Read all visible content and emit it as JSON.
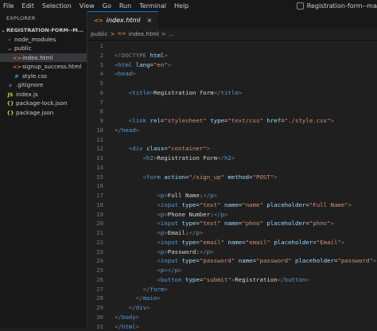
{
  "menu": [
    "File",
    "Edit",
    "Selection",
    "View",
    "Go",
    "Run",
    "Terminal",
    "Help"
  ],
  "window_title": "Registration-form--ma",
  "explorer": {
    "header": "EXPLORER",
    "root": "REGISTRATION-FORM--M...",
    "items": [
      {
        "label": "node_modules",
        "icon": "folder-collapsed",
        "indent": 1
      },
      {
        "label": "public",
        "icon": "folder-expanded",
        "indent": 1
      },
      {
        "label": "index.html",
        "icon": "html-icon",
        "indent": 2,
        "selected": true
      },
      {
        "label": "signup_success.html",
        "icon": "html-icon",
        "indent": 2
      },
      {
        "label": "style.css",
        "icon": "css-icon",
        "indent": 2
      },
      {
        "label": ".gitignore",
        "icon": "git-icon",
        "indent": 1
      },
      {
        "label": "index.js",
        "icon": "js-icon",
        "indent": 1
      },
      {
        "label": "package-lock.json",
        "icon": "json-icon",
        "indent": 1
      },
      {
        "label": "package.json",
        "icon": "json-icon",
        "indent": 1
      }
    ]
  },
  "tab": {
    "label": "index.html",
    "close": "×"
  },
  "breadcrumb": [
    "public",
    ">",
    "index.html",
    ">",
    "..."
  ],
  "code_lines": [
    [
      [
        "",
        ""
      ]
    ],
    [
      [
        "<!DOCTYPE ",
        "t"
      ],
      [
        "html",
        "a"
      ],
      [
        ">",
        "t"
      ]
    ],
    [
      [
        "<",
        "t"
      ],
      [
        "html",
        "g"
      ],
      [
        " ",
        ""
      ],
      [
        "lang",
        "a"
      ],
      [
        "=",
        "w"
      ],
      [
        "\"en\"",
        "s"
      ],
      [
        ">",
        "t"
      ]
    ],
    [
      [
        "<",
        "t"
      ],
      [
        "head",
        "g"
      ],
      [
        ">",
        "t"
      ]
    ],
    [
      [
        "",
        ""
      ]
    ],
    [
      [
        "    <",
        "t"
      ],
      [
        "title",
        "g"
      ],
      [
        ">",
        "t"
      ],
      [
        "Registration form",
        "w"
      ],
      [
        "</",
        "t"
      ],
      [
        "title",
        "g"
      ],
      [
        ">",
        "t"
      ]
    ],
    [
      [
        "",
        ""
      ]
    ],
    [
      [
        "",
        ""
      ]
    ],
    [
      [
        "    <",
        "t"
      ],
      [
        "link",
        "g"
      ],
      [
        " ",
        ""
      ],
      [
        "rel",
        "a"
      ],
      [
        "=",
        "w"
      ],
      [
        "\"stylesheet\"",
        "s"
      ],
      [
        " ",
        ""
      ],
      [
        "type",
        "a"
      ],
      [
        "=",
        "w"
      ],
      [
        "\"text/css\"",
        "s"
      ],
      [
        " ",
        ""
      ],
      [
        "href",
        "a"
      ],
      [
        "=",
        "w"
      ],
      [
        "\"./style.css\"",
        "s"
      ],
      [
        ">",
        "t"
      ]
    ],
    [
      [
        "</",
        "t"
      ],
      [
        "head",
        "g"
      ],
      [
        ">",
        "t"
      ]
    ],
    [
      [
        "",
        ""
      ]
    ],
    [
      [
        "    <",
        "t"
      ],
      [
        "div",
        "g"
      ],
      [
        " ",
        ""
      ],
      [
        "class",
        "a"
      ],
      [
        "=",
        "w"
      ],
      [
        "\"container\"",
        "s"
      ],
      [
        ">",
        "t"
      ]
    ],
    [
      [
        "        <",
        "t"
      ],
      [
        "h2",
        "g"
      ],
      [
        ">",
        "t"
      ],
      [
        "Registration Form",
        "w"
      ],
      [
        "</",
        "t"
      ],
      [
        "h2",
        "g"
      ],
      [
        ">",
        "t"
      ]
    ],
    [
      [
        "",
        ""
      ]
    ],
    [
      [
        "        <",
        "t"
      ],
      [
        "form",
        "g"
      ],
      [
        " ",
        ""
      ],
      [
        "action",
        "a"
      ],
      [
        "=",
        "w"
      ],
      [
        "\"/sign_up\"",
        "s"
      ],
      [
        " ",
        ""
      ],
      [
        "method",
        "a"
      ],
      [
        "=",
        "w"
      ],
      [
        "\"POST\"",
        "s"
      ],
      [
        ">",
        "t"
      ]
    ],
    [
      [
        "",
        ""
      ]
    ],
    [
      [
        "            <",
        "t"
      ],
      [
        "p",
        "g"
      ],
      [
        ">",
        "t"
      ],
      [
        "Full Name:",
        "w"
      ],
      [
        "</",
        "t"
      ],
      [
        "p",
        "g"
      ],
      [
        ">",
        "t"
      ]
    ],
    [
      [
        "            <",
        "t"
      ],
      [
        "input",
        "g"
      ],
      [
        " ",
        ""
      ],
      [
        "type",
        "a"
      ],
      [
        "=",
        "w"
      ],
      [
        "\"text\"",
        "s"
      ],
      [
        " ",
        ""
      ],
      [
        "name",
        "a"
      ],
      [
        "=",
        "w"
      ],
      [
        "\"name\"",
        "s"
      ],
      [
        " ",
        ""
      ],
      [
        "placeholder",
        "a"
      ],
      [
        "=",
        "w"
      ],
      [
        "\"Full Name\"",
        "s"
      ],
      [
        ">",
        "t"
      ]
    ],
    [
      [
        "            <",
        "t"
      ],
      [
        "p",
        "g"
      ],
      [
        ">",
        "t"
      ],
      [
        "Phone Number:",
        "w"
      ],
      [
        "</",
        "t"
      ],
      [
        "p",
        "g"
      ],
      [
        ">",
        "t"
      ]
    ],
    [
      [
        "            <",
        "t"
      ],
      [
        "input",
        "g"
      ],
      [
        " ",
        ""
      ],
      [
        "type",
        "a"
      ],
      [
        "=",
        "w"
      ],
      [
        "\"text\"",
        "s"
      ],
      [
        " ",
        ""
      ],
      [
        "name",
        "a"
      ],
      [
        "=",
        "w"
      ],
      [
        "\"phno\"",
        "s"
      ],
      [
        " ",
        ""
      ],
      [
        "placeholder",
        "a"
      ],
      [
        "=",
        "w"
      ],
      [
        "\"phno\"",
        "s"
      ],
      [
        ">",
        "t"
      ]
    ],
    [
      [
        "            <",
        "t"
      ],
      [
        "p",
        "g"
      ],
      [
        ">",
        "t"
      ],
      [
        "Email:",
        "w"
      ],
      [
        "</",
        "t"
      ],
      [
        "p",
        "g"
      ],
      [
        ">",
        "t"
      ]
    ],
    [
      [
        "            <",
        "t"
      ],
      [
        "input",
        "g"
      ],
      [
        " ",
        ""
      ],
      [
        "type",
        "a"
      ],
      [
        "=",
        "w"
      ],
      [
        "\"email\"",
        "s"
      ],
      [
        " ",
        ""
      ],
      [
        "name",
        "a"
      ],
      [
        "=",
        "w"
      ],
      [
        "\"email\"",
        "s"
      ],
      [
        " ",
        ""
      ],
      [
        "placeholder",
        "a"
      ],
      [
        "=",
        "w"
      ],
      [
        "\"Email\"",
        "s"
      ],
      [
        ">",
        "t"
      ]
    ],
    [
      [
        "            <",
        "t"
      ],
      [
        "p",
        "g"
      ],
      [
        ">",
        "t"
      ],
      [
        "Password:",
        "w"
      ],
      [
        "</",
        "t"
      ],
      [
        "p",
        "g"
      ],
      [
        ">",
        "t"
      ]
    ],
    [
      [
        "            <",
        "t"
      ],
      [
        "input",
        "g"
      ],
      [
        " ",
        ""
      ],
      [
        "type",
        "a"
      ],
      [
        "=",
        "w"
      ],
      [
        "\"password\"",
        "s"
      ],
      [
        " ",
        ""
      ],
      [
        "name",
        "a"
      ],
      [
        "=",
        "w"
      ],
      [
        "\"password\"",
        "s"
      ],
      [
        " ",
        ""
      ],
      [
        "placeholder",
        "a"
      ],
      [
        "=",
        "w"
      ],
      [
        "\"password\"",
        "s"
      ],
      [
        ">",
        "t"
      ]
    ],
    [
      [
        "            <",
        "t"
      ],
      [
        "p",
        "g"
      ],
      [
        ">",
        "t"
      ],
      [
        "</",
        "t"
      ],
      [
        "p",
        "g"
      ],
      [
        ">",
        "t"
      ]
    ],
    [
      [
        "            <",
        "t"
      ],
      [
        "button",
        "g"
      ],
      [
        " ",
        ""
      ],
      [
        "type",
        "a"
      ],
      [
        "=",
        "w"
      ],
      [
        "\"submit\"",
        "s"
      ],
      [
        ">",
        "t"
      ],
      [
        "Registration",
        "w"
      ],
      [
        "</",
        "t"
      ],
      [
        "button",
        "g"
      ],
      [
        ">",
        "t"
      ]
    ],
    [
      [
        "        </",
        "t"
      ],
      [
        "form",
        "g"
      ],
      [
        ">",
        "t"
      ]
    ],
    [
      [
        "      </",
        "t"
      ],
      [
        "main",
        "g"
      ],
      [
        ">",
        "t"
      ]
    ],
    [
      [
        "    </",
        "t"
      ],
      [
        "div",
        "g"
      ],
      [
        ">",
        "t"
      ]
    ],
    [
      [
        "</",
        "t"
      ],
      [
        "body",
        "g"
      ],
      [
        ">",
        "t"
      ]
    ],
    [
      [
        "</",
        "t"
      ],
      [
        "html",
        "g"
      ],
      [
        ">",
        "t"
      ]
    ]
  ],
  "colors": {
    "t": "#808080",
    "g": "#569cd6",
    "a": "#9cdcfe",
    "s": "#ce9178",
    "w": "#d4d4d4",
    "html-icon": "#e37933",
    "css-icon": "#519aba",
    "js-icon": "#cbcb41",
    "json-icon": "#cbcb41",
    "git-icon": "#41535b",
    "folder": "#c5c5c5"
  },
  "icons": {
    "html-icon": "<>",
    "css-icon": "#",
    "js-icon": "JS",
    "json-icon": "{}",
    "git-icon": "◆",
    "folder-collapsed": "›",
    "folder-expanded": "⌄"
  }
}
